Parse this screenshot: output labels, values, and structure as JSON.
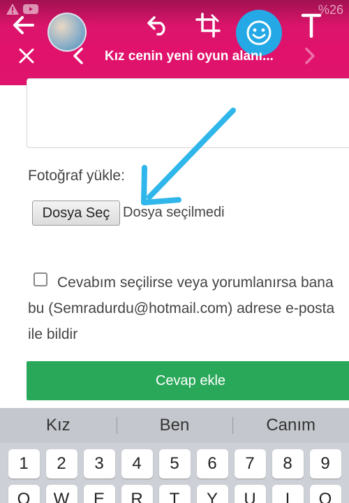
{
  "nav": {
    "title": "Kız cenin yeni oyun alanı...",
    "status_text": "%26"
  },
  "icons": {
    "warning": "warning-icon",
    "youtube": "youtube-icon",
    "back": "arrow-left-icon",
    "undo": "undo-icon",
    "crop": "crop-icon",
    "sticker": "smiley-icon",
    "text": "text-icon",
    "close": "close-icon",
    "prev": "chevron-left-icon",
    "next": "chevron-right-icon"
  },
  "form": {
    "upload_label": "Fotoğraf yükle:",
    "file_button": "Dosya Seç",
    "file_status": "Dosya seçilmedi",
    "notify_text": "Cevabım seçilirse veya yorumlanırsa bana bu (Semradurdu@hotmail.com) adrese e-posta ile bildir",
    "submit": "Cevap ekle"
  },
  "colors": {
    "topbar": "#e0126b",
    "sticker": "#25a9e6",
    "submit": "#2aa85a",
    "arrow": "#2fb6ea"
  },
  "keyboard": {
    "suggestions": [
      "Kız",
      "Ben",
      "Canım"
    ],
    "number_row": [
      "1",
      "2",
      "3",
      "4",
      "5",
      "6",
      "7",
      "8",
      "9"
    ],
    "letter_row": [
      "Q",
      "W",
      "E",
      "R",
      "T",
      "Y",
      "U",
      "I",
      "O"
    ]
  }
}
